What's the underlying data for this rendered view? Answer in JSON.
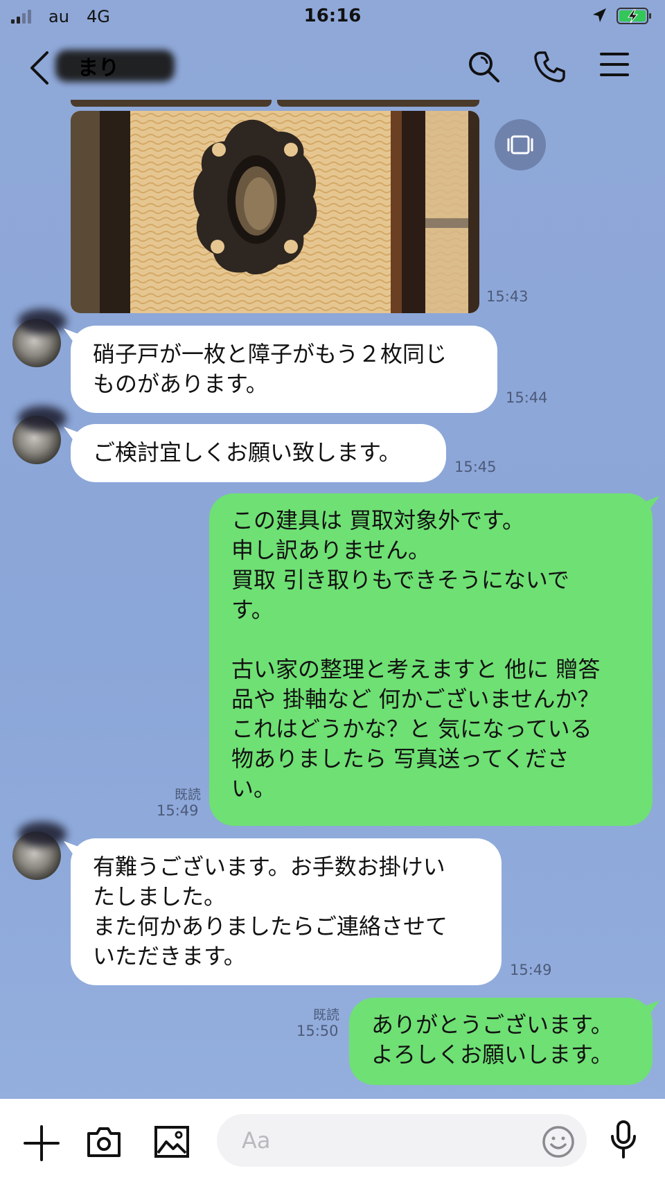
{
  "status_bar": {
    "carrier": "au",
    "network": "4G",
    "time": "16:16"
  },
  "header": {
    "contact_name": "まり",
    "icons": [
      "back-chevron-icon",
      "search-icon",
      "phone-icon",
      "menu-icon"
    ]
  },
  "messages": [
    {
      "side": "in",
      "type": "image",
      "time": "15:43"
    },
    {
      "side": "in",
      "text": "硝子戸が一枚と障子がもう２枚同じ\nものがあります。",
      "time": "15:44"
    },
    {
      "side": "in",
      "text": "ご検討宜しくお願い致します。",
      "time": "15:45"
    },
    {
      "side": "out",
      "text": "この建具は 買取対象外です。\n申し訳ありません。\n買取 引き取りもできそうにないで\nす。\n\n古い家の整理と考えますと 他に 贈答\n品や 掛軸など 何かございませんか？\nこれはどうかな？と 気になっている\n物ありましたら 写真送ってくださ\nい。",
      "read": "既読",
      "time": "15:49"
    },
    {
      "side": "in",
      "text": "有難うございます。お手数お掛けい\nたしました。\nまた何かありましたらご連絡させて\nいただきます。",
      "time": "15:49"
    },
    {
      "side": "out",
      "text": "ありがとうございます。\nよろしくお願いします。",
      "read": "既読",
      "time": "15:50"
    }
  ],
  "input_bar": {
    "placeholder": "Aa",
    "icons": [
      "plus-icon",
      "camera-icon",
      "image-icon",
      "emoji-icon",
      "microphone-icon"
    ]
  },
  "colors": {
    "background": "#8ca6d6",
    "incoming_bubble": "#ffffff",
    "outgoing_bubble": "#6fe074",
    "meta_text": "#4d5a78"
  }
}
